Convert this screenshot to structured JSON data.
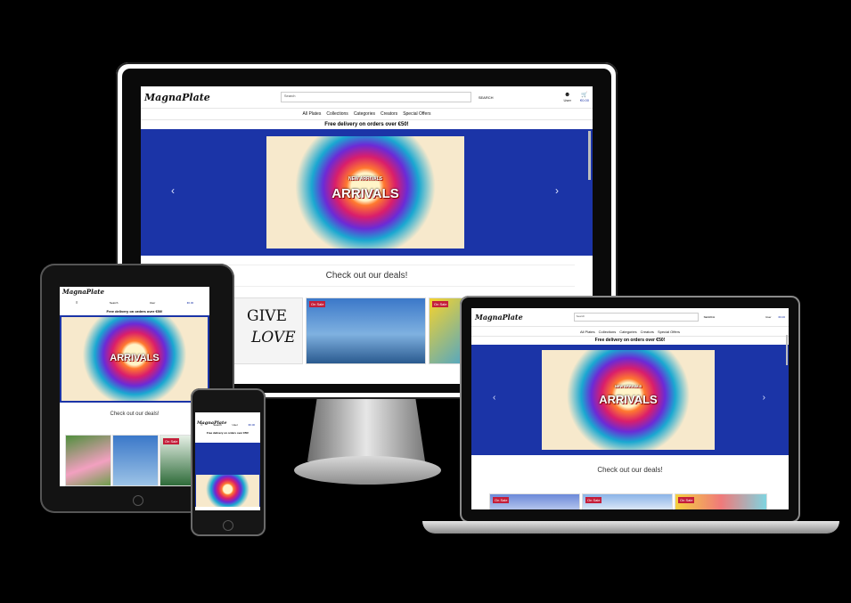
{
  "site": {
    "logo": "MagnaPlate",
    "search_placeholder": "Search",
    "search_button": "SEARCH",
    "user_label": "User",
    "cart_total": "€0.00",
    "nav": [
      "All Plates",
      "Collections",
      "Categories",
      "Creators",
      "Special Offers"
    ],
    "banner": "Free delivery on orders over €50!",
    "hero": {
      "title": "ARRIVALS",
      "subtitle": "NEW ARRIVALS",
      "tag": "NEW ARRIVALS",
      "new_tag": "NEW"
    },
    "deals_heading": "Check out our deals!",
    "deal_badge": "On Sale",
    "card_texts": [
      "GIVE",
      "LOVE"
    ]
  }
}
